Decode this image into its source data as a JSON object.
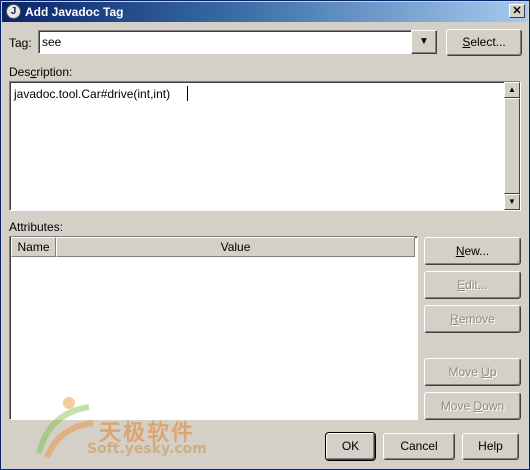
{
  "window": {
    "title": "Add Javadoc Tag",
    "close_glyph": "✕"
  },
  "tag": {
    "label": "Tag:",
    "value": "see",
    "dropdown_arrow": "▼",
    "select_button_prefix": "",
    "select_button_u": "S",
    "select_button_rest": "elect..."
  },
  "description": {
    "label_pre": "Des",
    "label_u": "c",
    "label_rest": "ription:",
    "text": "javadoc.tool.Car#drive(int,int)"
  },
  "attributes": {
    "label": "Attributes:",
    "columns": [
      "Name",
      "Value"
    ],
    "rows": []
  },
  "side_buttons": {
    "new": {
      "u": "N",
      "rest": "ew...",
      "enabled": true
    },
    "edit": {
      "u": "E",
      "rest": "dit...",
      "enabled": false
    },
    "remove": {
      "u": "R",
      "rest": "emove",
      "enabled": false
    },
    "move_up": {
      "pre": "Move ",
      "u": "U",
      "rest": "p",
      "enabled": false
    },
    "move_down": {
      "pre": "Move ",
      "u": "D",
      "rest": "own",
      "enabled": false
    }
  },
  "bottom_buttons": {
    "ok": "OK",
    "cancel": "Cancel",
    "help": "Help"
  },
  "watermark": {
    "cn": "天极软件",
    "en": "Soft.yesky.com"
  },
  "colors": {
    "titlebar_start": "#0a246a",
    "titlebar_end": "#a6caf0",
    "dialog_bg": "#d4d0c8"
  }
}
